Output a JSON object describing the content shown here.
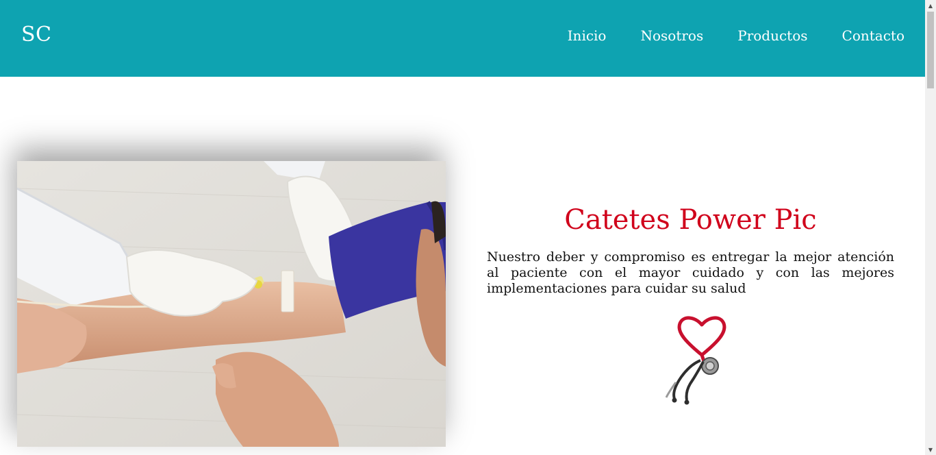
{
  "nav": {
    "logo": "SC",
    "links": [
      "Inicio",
      "Nosotros",
      "Productos",
      "Contacto"
    ]
  },
  "hero": {
    "title": "Catetes Power Pic",
    "description": "Nuestro deber y compromiso es entregar la mejor atención al paciente con el mayor cuidado y con las mejores implementaciones para cuidar su salud"
  },
  "colors": {
    "navbar": "#0ea3b1",
    "title": "#d0021b",
    "heart": "#c8102e"
  },
  "icons": {
    "photo": "iv-catheter-photo",
    "illustration": "stethoscope-heart-icon"
  }
}
